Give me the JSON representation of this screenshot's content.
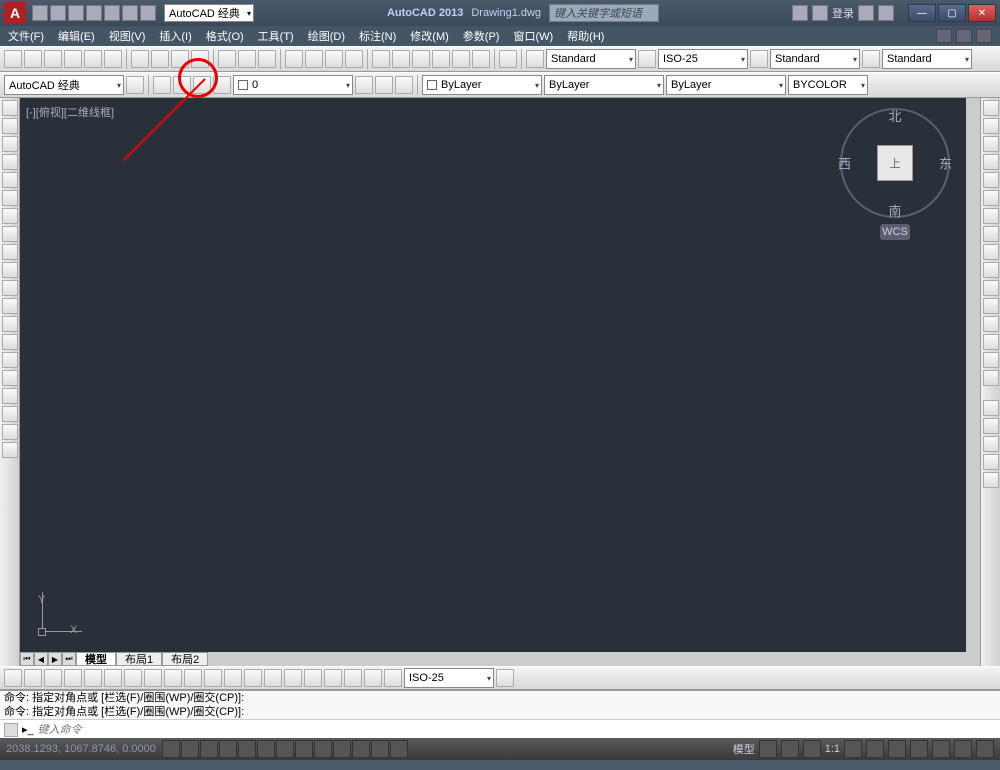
{
  "title": {
    "app": "AutoCAD 2013",
    "file": "Drawing1.dwg"
  },
  "workspace_dd": "AutoCAD 经典",
  "search": {
    "placeholder": "键入关键字或短语"
  },
  "login": "登录",
  "menubar": [
    "文件(F)",
    "编辑(E)",
    "视图(V)",
    "插入(I)",
    "格式(O)",
    "工具(T)",
    "绘图(D)",
    "标注(N)",
    "修改(M)",
    "参数(P)",
    "窗口(W)",
    "帮助(H)"
  ],
  "row1": {
    "textstyle": "Standard",
    "dimstyle": "ISO-25",
    "tablestyle": "Standard",
    "mleaderstyle": "Standard"
  },
  "row2": {
    "workspace": "AutoCAD 经典",
    "layer": "0",
    "prop_layer": "ByLayer",
    "prop_lt": "ByLayer",
    "prop_lw": "ByLayer",
    "prop_color": "BYCOLOR"
  },
  "viewport": {
    "label": "[-][俯视][二维线框]",
    "cube_face": "上",
    "dirs": {
      "n": "北",
      "s": "南",
      "e": "东",
      "w": "西"
    },
    "wcs": "WCS",
    "axis_x": "X",
    "axis_y": "Y"
  },
  "tabs": {
    "model": "模型",
    "layout1": "布局1",
    "layout2": "布局2"
  },
  "dim_dd": "ISO-25",
  "cmd": {
    "hist1": "命令: 指定对角点或 [栏选(F)/圈围(WP)/圈交(CP)]:",
    "hist2": "命令: 指定对角点或 [栏选(F)/圈围(WP)/圈交(CP)]:",
    "placeholder": "键入命令"
  },
  "status": {
    "coords": "2038.1293, 1067.8746, 0.0000",
    "model": "模型",
    "scale": "1:1"
  }
}
